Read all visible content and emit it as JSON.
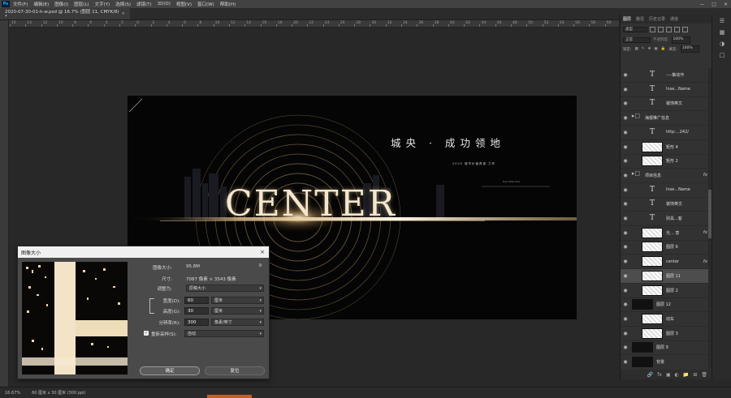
{
  "menu": {
    "app_logo": "Ps",
    "items": [
      "文件(F)",
      "编辑(E)",
      "图像(I)",
      "图层(L)",
      "文字(Y)",
      "选择(S)",
      "滤镜(T)",
      "3D(D)",
      "视图(V)",
      "窗口(W)",
      "帮助(H)"
    ]
  },
  "document_tab": {
    "title": "2020-07-30-01-h-w.psd @ 16.7% (图层 11, CMYK/8) *",
    "close": "×"
  },
  "ruler": {
    "ticks": [
      "16",
      "14",
      "12",
      "10",
      "8",
      "6",
      "4",
      "2",
      "0",
      "2",
      "4",
      "6",
      "8",
      "10",
      "12",
      "14",
      "16",
      "18",
      "20",
      "22",
      "24",
      "26",
      "28",
      "30",
      "32",
      "34",
      "36",
      "38",
      "40",
      "42",
      "44",
      "46",
      "48",
      "50",
      "52",
      "54",
      "56",
      "58",
      "60"
    ]
  },
  "artwork": {
    "headline": "城央 · 成功领地",
    "subline": "2020 城市价值再造 力作",
    "small_text": "Hua Shan Vue",
    "center_word": "CENTER"
  },
  "panel": {
    "tabs": [
      "图层",
      "路径",
      "历史记录",
      "通道"
    ],
    "kind_label": "类型",
    "blend_mode": "正常",
    "opacity_label": "不透明度:",
    "opacity_value": "100%",
    "lock_label": "锁定:",
    "fill_label": "填充:",
    "fill_value": "100%",
    "layers": [
      {
        "kind": "type",
        "name": "----策动作"
      },
      {
        "kind": "type",
        "name": "Inse...Name"
      },
      {
        "kind": "type",
        "name": "装饰英文"
      },
      {
        "kind": "folder",
        "name": "海报推广信息"
      },
      {
        "kind": "type",
        "name": "http:...242/"
      },
      {
        "kind": "image",
        "name": "矩形 4"
      },
      {
        "kind": "image",
        "name": "矩形 2"
      },
      {
        "kind": "folder",
        "name": "项目信息",
        "fx": "fx"
      },
      {
        "kind": "type",
        "name": "Inse...Name"
      },
      {
        "kind": "type",
        "name": "装饰英文"
      },
      {
        "kind": "type",
        "name": "别具...客"
      },
      {
        "kind": "image",
        "name": "光... 意",
        "fx": "fx"
      },
      {
        "kind": "image",
        "name": "图层 6"
      },
      {
        "kind": "image",
        "name": "center",
        "fx": "fx"
      },
      {
        "kind": "image",
        "name": "图层 11"
      },
      {
        "kind": "image",
        "name": "图层 2"
      },
      {
        "kind": "dark",
        "name": "图层 12"
      },
      {
        "kind": "image",
        "name": "动车"
      },
      {
        "kind": "image",
        "name": "图层 3"
      },
      {
        "kind": "dark",
        "name": "图层 9"
      },
      {
        "kind": "dark",
        "name": "背景"
      }
    ],
    "bottom_icons": [
      "link-icon",
      "fx-icon",
      "mask-icon",
      "adjustment-icon",
      "folder-icon",
      "new-layer-icon",
      "trash-icon"
    ]
  },
  "status": {
    "zoom": "16.67%",
    "doc_info": "60 厘米 x 30 厘米 (300 ppi)"
  },
  "dialog": {
    "title": "图像大小",
    "close": "×",
    "image_size_label": "图像大小:",
    "image_size_value": "95.8M",
    "dimensions_label": "尺寸:",
    "dimensions_value": "7087 像素 × 3543 像素",
    "fit_label": "调整为:",
    "fit_value": "原稿大小",
    "width_label": "宽度(D):",
    "width_value": "60",
    "width_unit": "厘米",
    "height_label": "高度(G):",
    "height_value": "30",
    "height_unit": "厘米",
    "resolution_label": "分辨率(R):",
    "resolution_value": "300",
    "resolution_unit": "像素/英寸",
    "resample_label": "重新采样(S):",
    "resample_value": "自动",
    "ok_label": "确定",
    "reset_label": "复位"
  },
  "colors": {
    "app_bg": "#282828",
    "panel_bg": "#323232",
    "accent_gold": "#f4e6cf",
    "taskbar_accent": "#c0602a"
  }
}
